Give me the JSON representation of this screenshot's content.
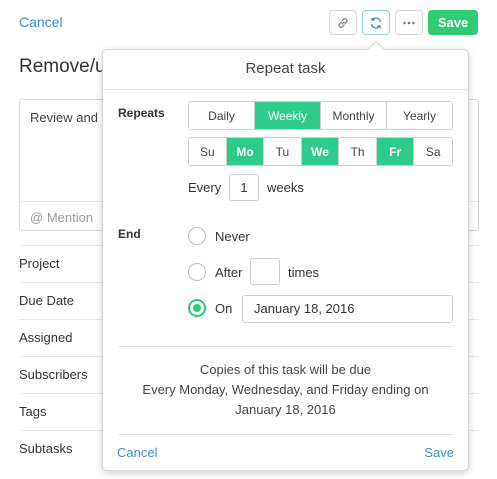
{
  "toolbar": {
    "cancel_label": "Cancel",
    "save_label": "Save",
    "icons": [
      "link-icon",
      "repeat-icon",
      "more-icon"
    ],
    "accent_color": "#2ecc71",
    "link_color": "#3a8dd8"
  },
  "task": {
    "title": "Remove/up",
    "description": "Review and",
    "mention_placeholder": "Mention"
  },
  "fields": [
    {
      "label": "Project"
    },
    {
      "label": "Due Date"
    },
    {
      "label": "Assigned"
    },
    {
      "label": "Subscribers"
    },
    {
      "label": "Tags"
    },
    {
      "label": "Subtasks"
    }
  ],
  "repeat": {
    "title": "Repeat task",
    "repeats_label": "Repeats",
    "frequencies": [
      {
        "label": "Daily",
        "selected": false
      },
      {
        "label": "Weekly",
        "selected": true
      },
      {
        "label": "Monthly",
        "selected": false
      },
      {
        "label": "Yearly",
        "selected": false
      }
    ],
    "days": [
      {
        "label": "Su",
        "selected": false
      },
      {
        "label": "Mo",
        "selected": true
      },
      {
        "label": "Tu",
        "selected": false
      },
      {
        "label": "We",
        "selected": true
      },
      {
        "label": "Th",
        "selected": false
      },
      {
        "label": "Fr",
        "selected": true
      },
      {
        "label": "Sa",
        "selected": false
      }
    ],
    "every_label": "Every",
    "every_value": "1",
    "weeks_label": "weeks",
    "end_label": "End",
    "end_options": {
      "never": "Never",
      "after": "After",
      "times": "times",
      "on": "On"
    },
    "end_selected": "on",
    "end_date": "January 18, 2016",
    "summary_line1": "Copies of this task will be due",
    "summary_line2": "Every Monday, Wednesday, and Friday ending on",
    "summary_line3": "January 18, 2016",
    "cancel_label": "Cancel",
    "save_label": "Save"
  }
}
